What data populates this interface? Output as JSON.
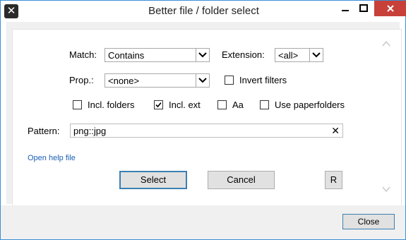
{
  "window": {
    "title": "Better file / folder select"
  },
  "form": {
    "match_label": "Match:",
    "match_value": "Contains",
    "extension_label": "Extension:",
    "extension_value": "<all>",
    "prop_label": "Prop.:",
    "prop_value": "<none>",
    "invert_label": "Invert filters",
    "invert_checked": false,
    "incl_folders_label": "Incl. folders",
    "incl_folders_checked": false,
    "incl_ext_label": "Incl. ext",
    "incl_ext_checked": true,
    "aa_label": "Aa",
    "aa_checked": false,
    "paperfolders_label": "Use paperfolders",
    "paperfolders_checked": false,
    "pattern_label": "Pattern:",
    "pattern_value": "png::jpg",
    "clear_glyph": "✕"
  },
  "help_link": "Open help file",
  "buttons": {
    "select": "Select",
    "cancel": "Cancel",
    "r": "R",
    "close": "Close"
  },
  "icons": {
    "app": "app-logo-icon",
    "minimize": "minimize-icon",
    "maximize": "maximize-icon",
    "close": "close-icon",
    "dropdown": "chevron-down-icon",
    "check": "checkmark-icon",
    "scroll_up": "chevron-up-icon",
    "scroll_down": "chevron-down-icon"
  },
  "colors": {
    "accent": "#3c7fb1",
    "close_red": "#c7413a",
    "link": "#1a5fb4"
  }
}
